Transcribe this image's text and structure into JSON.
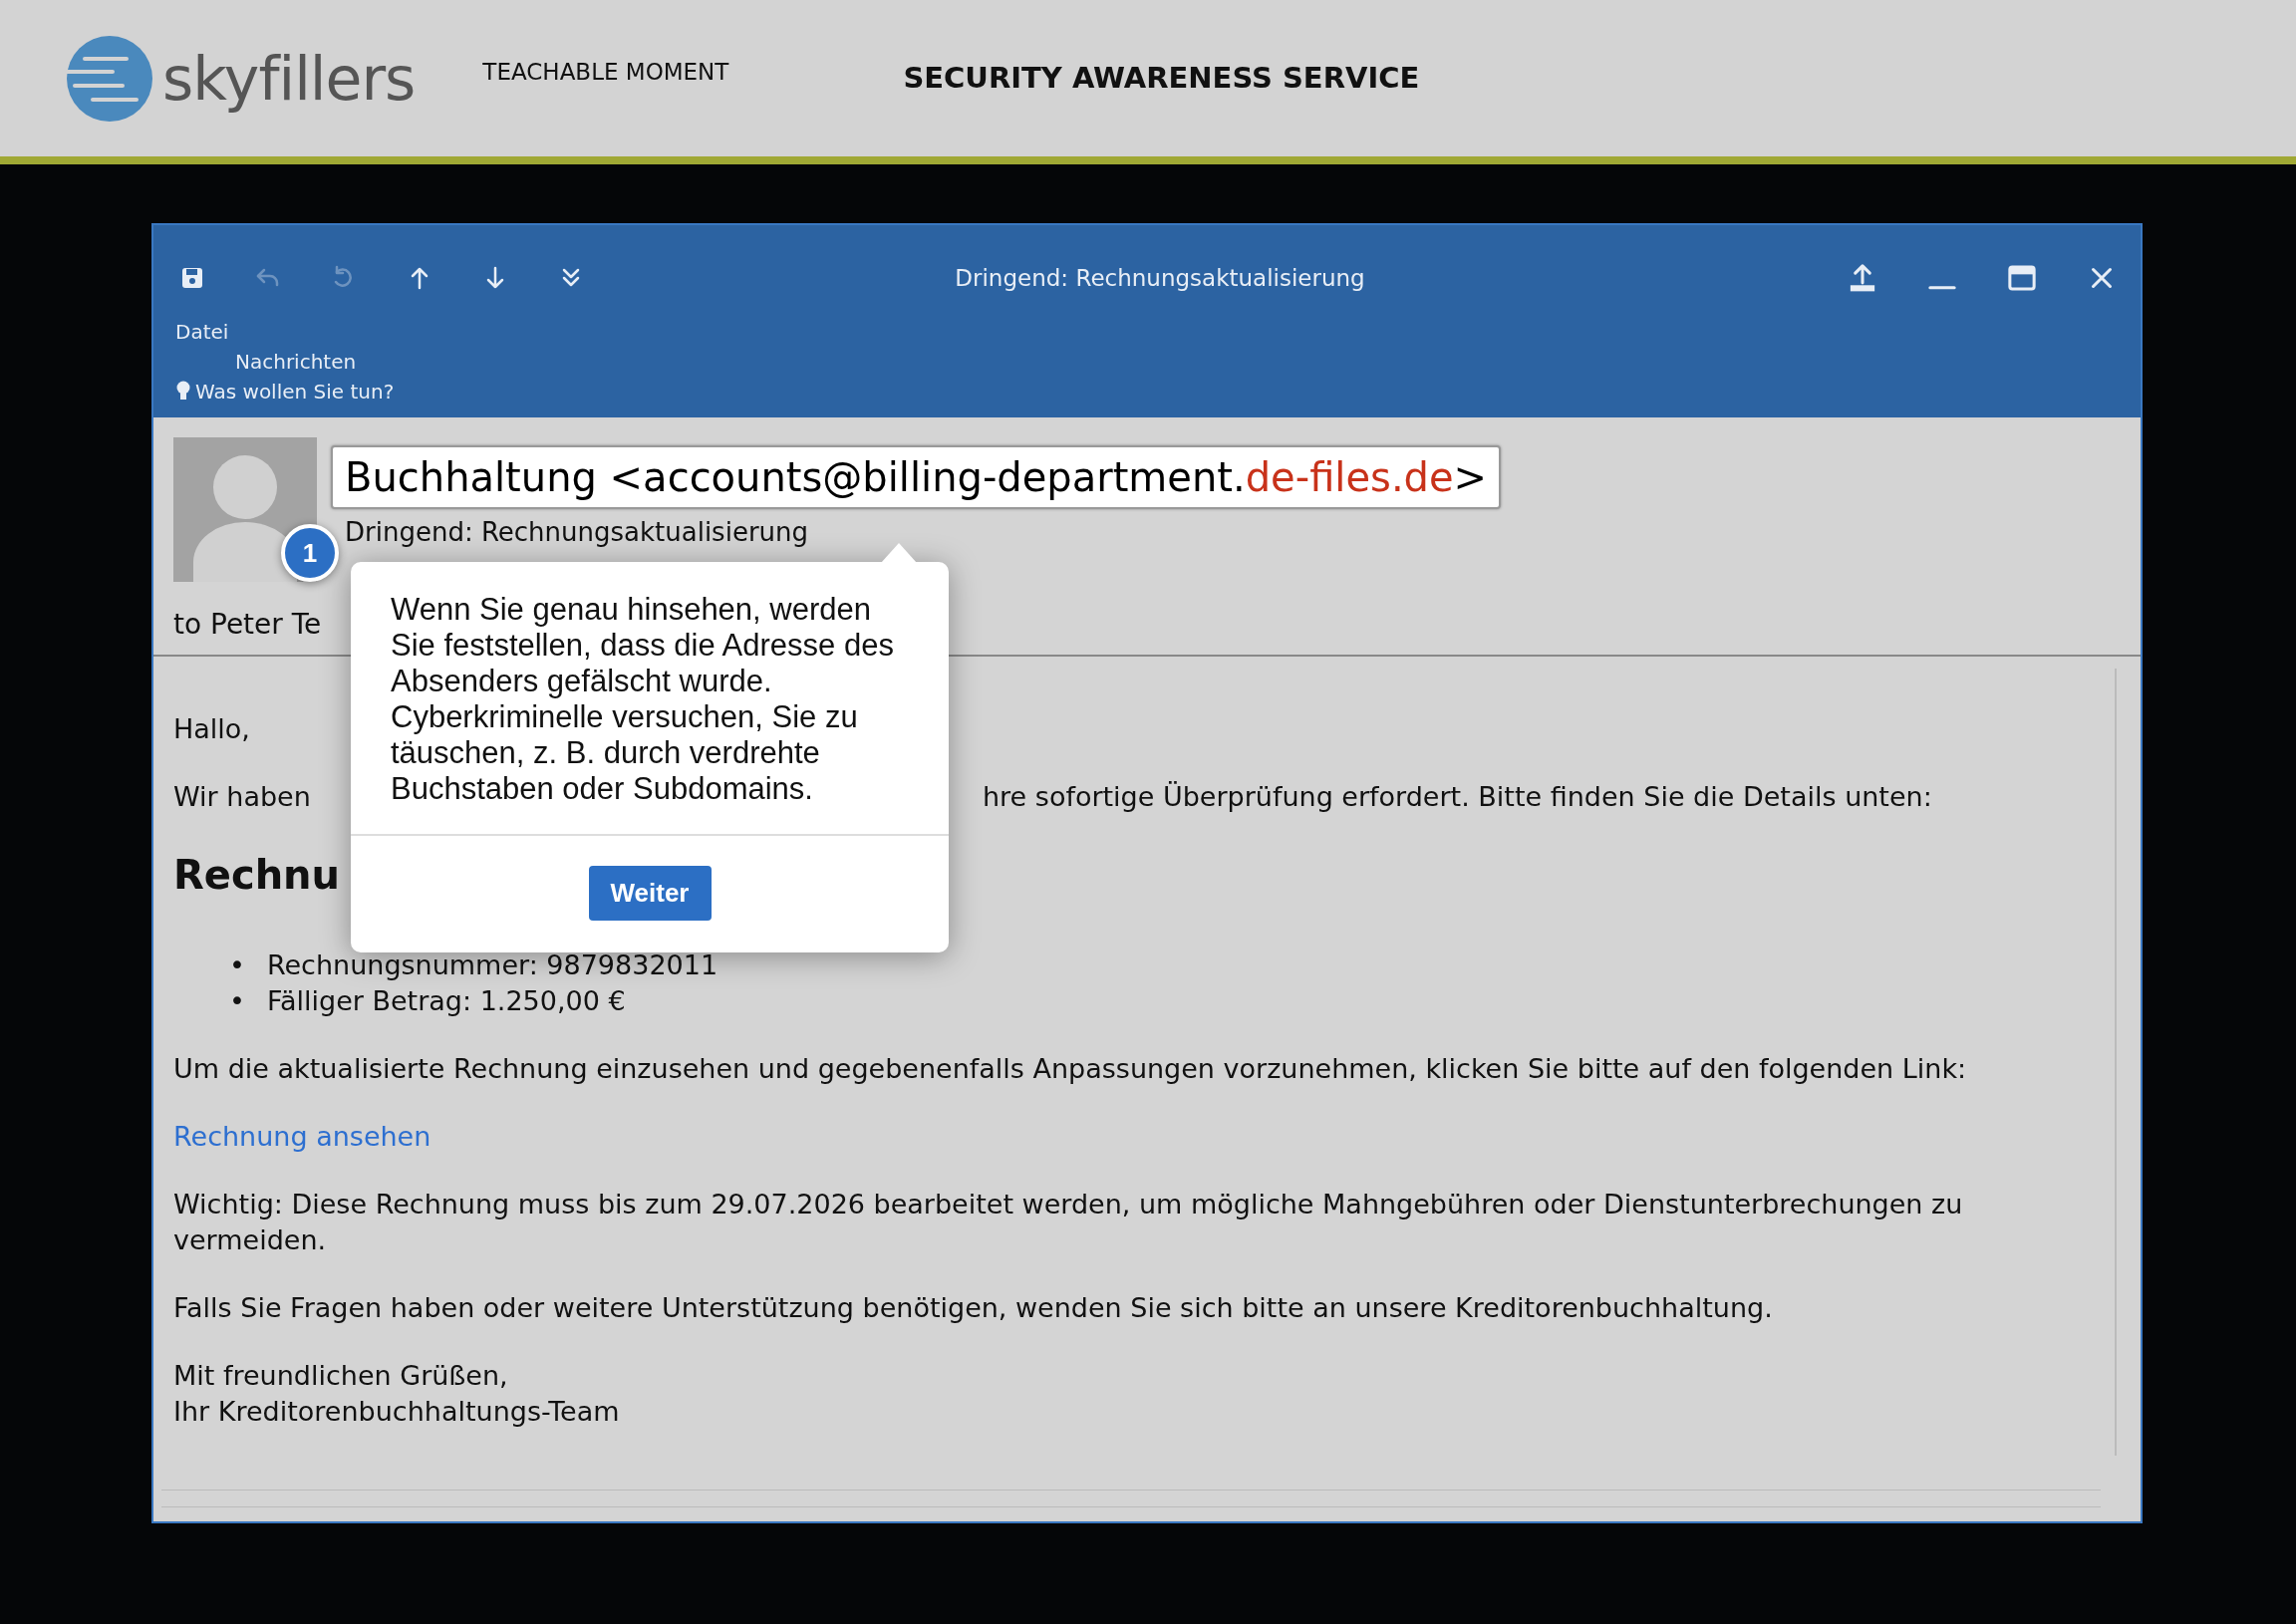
{
  "brand": {
    "logo": "skyfillers",
    "tagline": "TEACHABLE MOMENT",
    "service": "SECURITY AWARENESS SERVICE"
  },
  "window": {
    "title": "Dringend: Rechnungsaktualisierung",
    "toolbar": [
      {
        "disabled": false
      },
      {
        "disabled": true
      },
      {
        "disabled": true
      },
      {
        "disabled": false
      },
      {
        "disabled": false
      },
      {
        "disabled": false
      }
    ],
    "menu": [
      "Datei",
      "Nachrichten"
    ],
    "tell_me": "Was wollen Sie tun?"
  },
  "email": {
    "sender_prefix": "Buchhaltung <accounts@billing-department.",
    "sender_suspicious": "de-files.de",
    "sender_suffix": ">",
    "subject": "Dringend: Rechnungsaktualisierung",
    "to": "to Peter Te",
    "body": [
      {
        "kind": "paragraph",
        "text": "Hallo,"
      },
      {
        "kind": "split",
        "before": "Wir haben",
        "after": "hre sofortige Überprüfung erfordert. Bitte finden Sie die Details unten:"
      },
      {
        "kind": "heading",
        "text": "Rechnu"
      },
      {
        "kind": "list",
        "items": [
          {
            "marker": "•",
            "text": "Rechnungsnummer: 9879832011"
          },
          {
            "marker": "•",
            "text": "Fälliger Betrag: 1.250,00 €"
          }
        ]
      },
      {
        "kind": "paragraph",
        "text": "Um die aktualisierte Rechnung einzusehen und gegebenenfalls Anpassungen vorzunehmen, klicken Sie bitte auf den folgenden Link:"
      },
      {
        "kind": "link",
        "text": "Rechnung ansehen"
      },
      {
        "kind": "paragraph",
        "text": "Wichtig: Diese Rechnung muss bis zum 29.07.2026 bearbeitet werden, um mögliche Mahngebühren oder Dienstunterbrechungen zu vermeiden."
      },
      {
        "kind": "paragraph",
        "text": "Falls Sie Fragen haben oder weitere Unterstützung benötigen, wenden Sie sich bitte an unsere Kreditorenbuchhaltung."
      },
      {
        "kind": "lines",
        "lines": [
          "Mit freundlichen Grüßen,",
          "Ihr Kreditorenbuchhaltungs-Team"
        ]
      }
    ]
  },
  "tooltip": {
    "step": "1",
    "text": "Wenn Sie genau hinsehen, werden Sie feststellen, dass die Adresse des Absenders gefälscht wurde. Cyberkriminelle versuchen, Sie zu täuschen, z. B. durch verdrehte Buchstaben oder Subdomains.",
    "button": "Weiter"
  }
}
